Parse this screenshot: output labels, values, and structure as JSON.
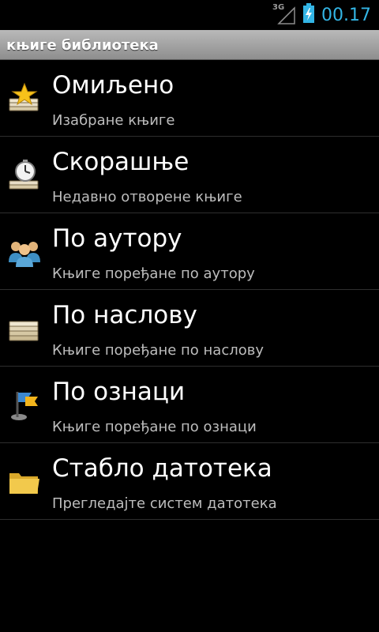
{
  "status": {
    "network": "3G",
    "time": "00.17",
    "clock_color": "#33b5e5"
  },
  "header": {
    "title": "књиге библиотека"
  },
  "menu": {
    "items": [
      {
        "label": "Омиљено",
        "subtitle": "Изабране књиге",
        "icon": "favorite-books-icon"
      },
      {
        "label": "Скорашње",
        "subtitle": "Недавно отворене књиге",
        "icon": "recent-books-icon"
      },
      {
        "label": "По аутору",
        "subtitle": "Књиге поређане по аутору",
        "icon": "authors-icon"
      },
      {
        "label": "По наслову",
        "subtitle": "Књиге поређане по наслову",
        "icon": "books-stack-icon"
      },
      {
        "label": "По ознаци",
        "subtitle": "Књиге поређане по ознаци",
        "icon": "tag-flag-icon"
      },
      {
        "label": "Стабло датотека",
        "subtitle": "Прегледајте систем датотека",
        "icon": "folder-icon"
      }
    ]
  }
}
